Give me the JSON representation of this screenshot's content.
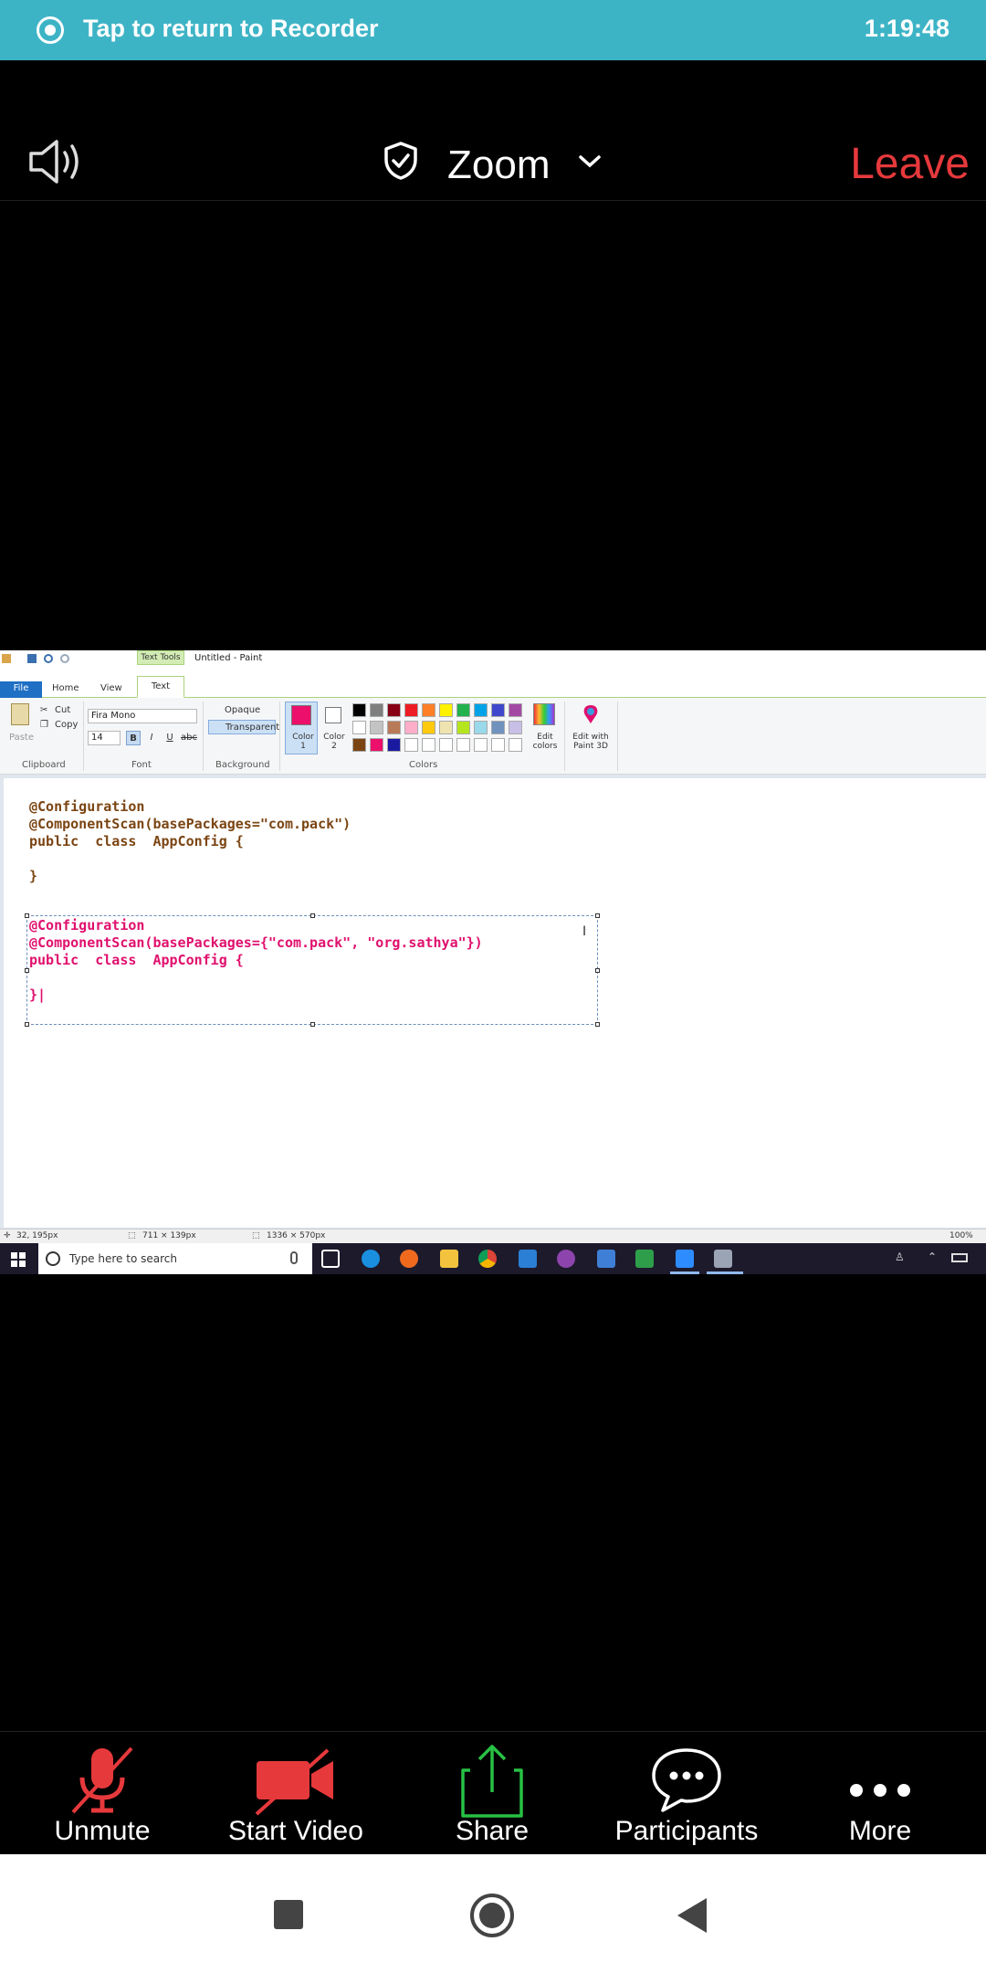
{
  "recorder": {
    "text": "Tap to return to Recorder",
    "time": "1:19:48"
  },
  "header": {
    "title": "Zoom",
    "leave_label": "Leave"
  },
  "paint": {
    "window_title": "Untitled - Paint",
    "context_tab": "Text Tools",
    "tabs": [
      "File",
      "Home",
      "View",
      "Text"
    ],
    "clipboard": {
      "paste": "Paste",
      "cut": "Cut",
      "copy": "Copy",
      "group": "Clipboard"
    },
    "font": {
      "name": "Fira Mono",
      "size": "14",
      "group": "Font"
    },
    "background": {
      "opaque": "Opaque",
      "transparent": "Transparent",
      "group": "Background"
    },
    "colors": {
      "color1_label": "Color 1",
      "color2_label": "Color 2",
      "edit_colors": "Edit colors",
      "edit_paint3d": "Edit with Paint 3D",
      "group": "Colors",
      "color1": "#ec0f6c",
      "color2": "#ffffff",
      "palette_row1": [
        "#000000",
        "#7f7f7f",
        "#880015",
        "#ed1c24",
        "#ff7f27",
        "#fff200",
        "#22b14c",
        "#00a2e8",
        "#3f48cc",
        "#a349a4"
      ],
      "palette_row2": [
        "#ffffff",
        "#c3c3c3",
        "#b97a57",
        "#ffaec9",
        "#ffc90e",
        "#efe4b0",
        "#b5e61d",
        "#99d9ea",
        "#7092be",
        "#c8bfe7"
      ],
      "palette_row3": [
        "#7b4513",
        "#ec0f6c",
        "#1a1aa0",
        "#ffffff",
        "#ffffff",
        "#ffffff",
        "#ffffff",
        "#ffffff",
        "#ffffff",
        "#ffffff"
      ]
    },
    "code_block_1": "@Configuration\n@ComponentScan(basePackages=\"com.pack\")\npublic  class  AppConfig {\n\n}",
    "code_block_2": "@Configuration\n@ComponentScan(basePackages={\"com.pack\", \"org.sathya\"})\npublic  class  AppConfig {\n\n}|",
    "status": {
      "cursor": "32, 195px",
      "selection": "711 × 139px",
      "canvas": "1336 × 570px",
      "zoom": "100%"
    },
    "taskbar": {
      "search_placeholder": "Type here to search"
    }
  },
  "toolbar": {
    "unmute": "Unmute",
    "start_video": "Start Video",
    "share": "Share",
    "participants": "Participants",
    "more": "More"
  }
}
